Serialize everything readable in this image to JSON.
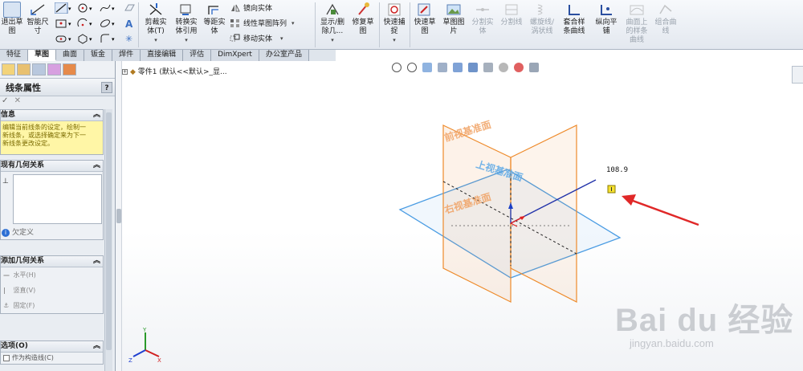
{
  "ribbon": {
    "exit_sketch": "退出草\n图",
    "smart_dimension": "智能尺\n寸",
    "trim_entities": "剪裁实\n体(T)",
    "convert_entities": "转换实\n体引用",
    "offset_entities": "等距实\n体",
    "mirror_entities": "镜向实体",
    "linear_pattern": "线性草图阵列",
    "move_entities": "移动实体",
    "display_delete_relations": "显示/删\n除几...",
    "repair_sketch": "修复草\n图",
    "quick_snaps": "快速捕\n捉",
    "rapid_sketch": "快速草\n图",
    "sketch_picture": "草图图\n片",
    "split_entities": "分割实\n体",
    "split_line": "分割线",
    "helix_spiral": "螺旋线/\n涡状线",
    "fit_spline": "套合样\n条曲线",
    "vertical_plane": "纵向平\n铺",
    "curve_on_surface": "曲面上\n的样条\n曲线",
    "composite_curve": "组合曲\n线"
  },
  "tabs": [
    "特征",
    "草图",
    "曲面",
    "钣金",
    "焊件",
    "直接编辑",
    "评估",
    "DimXpert",
    "办公室产品"
  ],
  "active_tab": "草图",
  "property_manager": {
    "title": "线条属性",
    "help": "?",
    "confirm": "✓",
    "cancel": "✕",
    "message_group": {
      "title": "信息",
      "text": "编辑当前线条的设定，绘制一\n新线条，或选择确定来为下一\n新线条更改设定。"
    },
    "existing_relations": {
      "title": "现有几何关系",
      "status": "欠定义"
    },
    "add_relations": {
      "title": "添加几何关系",
      "items": [
        "水平(H)",
        "竖直(V)",
        "固定(F)"
      ]
    },
    "options": {
      "title": "选项(O)",
      "construction": "作为构造线(C)"
    }
  },
  "tree": {
    "part": "零件1 (默认<<默认>_显..."
  },
  "viewport": {
    "dimension": "108.9",
    "plane_labels": [
      "前视基准面",
      "上视基准面",
      "右视基准面"
    ],
    "triad": {
      "x": "X",
      "y": "Y",
      "z": "Z"
    },
    "plane_colors": {
      "front": "#ee8a2a",
      "top": "#4a9ce3",
      "sketch_line": "#2233aa",
      "arrow": "#e03030"
    }
  },
  "watermark": {
    "brand": "Bai du 经验",
    "url": "jingyan.baidu.com"
  }
}
